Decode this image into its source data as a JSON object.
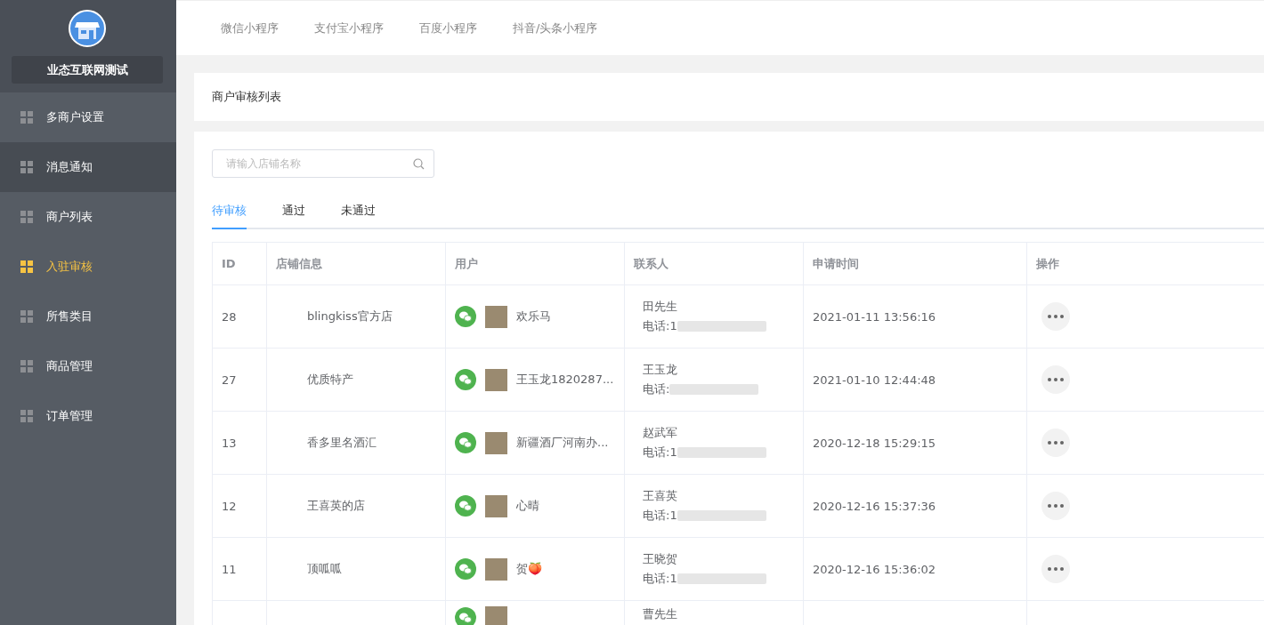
{
  "sidebar": {
    "brand": "业态互联网测试",
    "items": [
      {
        "label": "多商户设置",
        "selected": false,
        "highlighted": false
      },
      {
        "label": "消息通知",
        "selected": false,
        "highlighted": true
      },
      {
        "label": "商户列表",
        "selected": false,
        "highlighted": false
      },
      {
        "label": "入驻审核",
        "selected": true,
        "highlighted": false
      },
      {
        "label": "所售类目",
        "selected": false,
        "highlighted": false
      },
      {
        "label": "商品管理",
        "selected": false,
        "highlighted": false
      },
      {
        "label": "订单管理",
        "selected": false,
        "highlighted": false
      }
    ]
  },
  "top_tabs": [
    {
      "label": "微信小程序"
    },
    {
      "label": "支付宝小程序"
    },
    {
      "label": "百度小程序"
    },
    {
      "label": "抖音/头条小程序"
    }
  ],
  "page_title": "商户审核列表",
  "search": {
    "placeholder": "请输入店铺名称"
  },
  "status_tabs": [
    {
      "label": "待审核",
      "selected": true
    },
    {
      "label": "通过",
      "selected": false
    },
    {
      "label": "未通过",
      "selected": false
    }
  ],
  "table": {
    "columns": [
      "ID",
      "店铺信息",
      "用户",
      "联系人",
      "申请时间",
      "操作"
    ],
    "rows": [
      {
        "id": "28",
        "shop": "blingkiss官方店",
        "user": "欢乐马",
        "contact": "田先生",
        "phone": "电话:1",
        "time": "2021-01-11 13:56:16"
      },
      {
        "id": "27",
        "shop": "优质特产",
        "user": "王玉龙1820287...",
        "contact": "王玉龙",
        "phone": "电话:",
        "time": "2021-01-10 12:44:48"
      },
      {
        "id": "13",
        "shop": "香多里名酒汇",
        "user": "新疆酒厂河南办...",
        "contact": "赵武军",
        "phone": "电话:1",
        "time": "2020-12-18 15:29:15"
      },
      {
        "id": "12",
        "shop": "王喜英的店",
        "user": "心晴",
        "contact": "王喜英",
        "phone": "电话:1",
        "time": "2020-12-16 15:37:36"
      },
      {
        "id": "11",
        "shop": "顶呱呱",
        "user": "贺🍑",
        "contact": "王晓贺",
        "phone": "电话:1",
        "time": "2020-12-16 15:36:02"
      },
      {
        "contact": "曹先生"
      }
    ]
  }
}
